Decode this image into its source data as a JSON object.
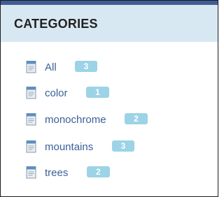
{
  "widget": {
    "title": "CATEGORIES",
    "colors": {
      "top_bar": "#3f5e95",
      "header_bg": "#d8e8f2",
      "link": "#3a5f9a",
      "badge_bg": "#9cd3e6",
      "badge_text": "#ffffff"
    },
    "items": [
      {
        "label": "All",
        "count": "3",
        "icon": "document-icon"
      },
      {
        "label": "color",
        "count": "1",
        "icon": "document-icon"
      },
      {
        "label": "monochrome",
        "count": "2",
        "icon": "document-icon"
      },
      {
        "label": "mountains",
        "count": "3",
        "icon": "document-icon"
      },
      {
        "label": "trees",
        "count": "2",
        "icon": "document-icon"
      }
    ]
  }
}
